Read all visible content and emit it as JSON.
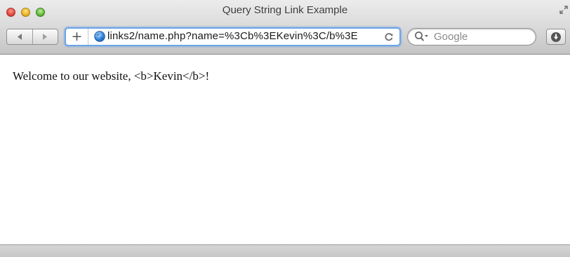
{
  "window": {
    "title": "Query String Link Example"
  },
  "toolbar": {
    "back_icon": "back-arrow-icon",
    "forward_icon": "forward-arrow-icon",
    "add_bookmark_label": "+",
    "address": {
      "url": "links2/name.php?name=%3Cb%3EKevin%3C/b%3E",
      "site_icon": "globe-icon",
      "reload_icon": "reload-icon"
    },
    "search": {
      "placeholder": "Google",
      "icon": "search-icon"
    },
    "download_icon": "download-icon"
  },
  "page": {
    "text": "Welcome to our website, <b>Kevin</b>!"
  },
  "colors": {
    "address_focus": "#6da4e6",
    "close": "#e2463a",
    "minimize": "#e9b327",
    "maximize": "#63b83d"
  }
}
